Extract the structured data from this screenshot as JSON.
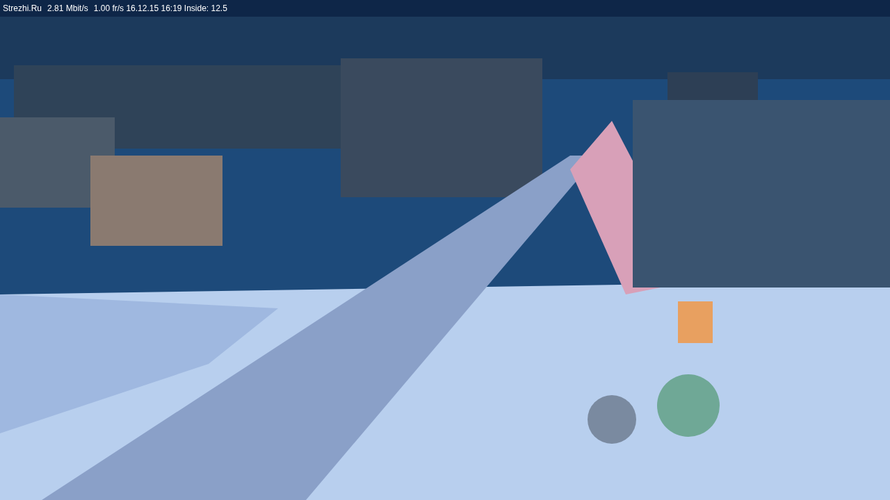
{
  "status_bar": {
    "items": [
      "Strezhi.Ru",
      "2.81 Mbit/s",
      "1.00 fr/s 16.12.15 16:19 Inside: 12.5"
    ]
  }
}
